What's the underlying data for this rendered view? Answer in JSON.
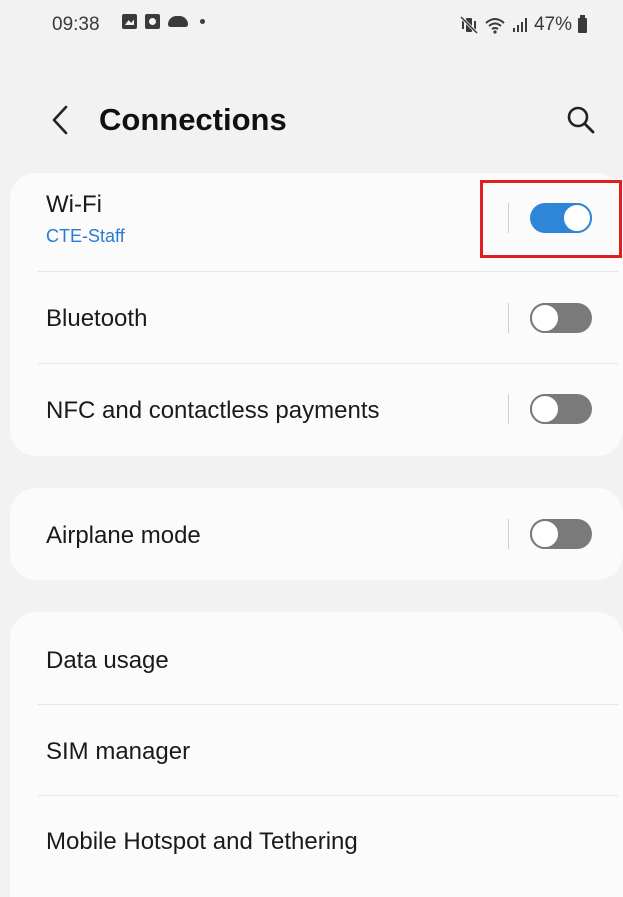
{
  "status_bar": {
    "time": "09:38",
    "battery": "47%",
    "icons": [
      "photo-icon",
      "gallery-icon",
      "cloud-icon",
      "notification-dot-icon",
      "mute-vibrate-icon",
      "wifi-icon",
      "signal-icon",
      "battery-icon"
    ]
  },
  "header": {
    "title": "Connections",
    "back_icon": "chevron-left-icon",
    "search_icon": "search-icon"
  },
  "groups": [
    {
      "items": [
        {
          "label": "Wi-Fi",
          "sublabel": "CTE-Staff",
          "toggle": true
        },
        {
          "label": "Bluetooth",
          "toggle": false
        },
        {
          "label": "NFC and contactless payments",
          "toggle": false
        }
      ]
    },
    {
      "items": [
        {
          "label": "Airplane mode",
          "toggle": false
        }
      ]
    },
    {
      "items": [
        {
          "label": "Data usage"
        },
        {
          "label": "SIM manager"
        },
        {
          "label": "Mobile Hotspot and Tethering"
        }
      ]
    }
  ],
  "colors": {
    "accent": "#2f86d9",
    "toggle_off": "#7a7a7a",
    "highlight_box": "#e02020",
    "background": "#f2f2f2",
    "card": "#fbfbfb"
  }
}
